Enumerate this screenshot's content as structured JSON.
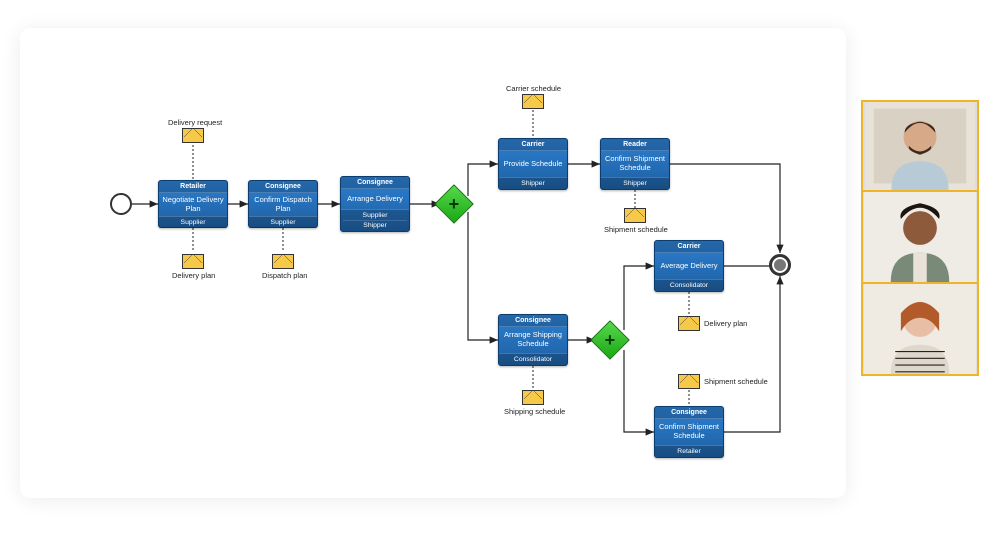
{
  "diagram": {
    "start": {
      "type": "start-event"
    },
    "end": {
      "type": "end-event"
    },
    "gateways": {
      "g1": {
        "symbol": "+"
      },
      "g2": {
        "symbol": "+"
      }
    },
    "tasks": {
      "negotiate": {
        "role_top": "Retailer",
        "title": "Negotiate Delivery Plan",
        "role_bottom": "Supplier"
      },
      "confirmDispatch": {
        "role_top": "Consignee",
        "title": "Confirm Dispatch Plan",
        "role_bottom": "Supplier"
      },
      "arrangeDelivery": {
        "role_top": "Consignee",
        "title": "Arrange Delivery",
        "role_bottom1": "Supplier",
        "role_bottom2": "Shipper"
      },
      "provideSchedule": {
        "role_top": "Carrier",
        "title": "Provide Schedule",
        "role_bottom": "Shipper"
      },
      "confirmShipment1": {
        "role_top": "Reader",
        "title": "Confirm Shipment Schedule",
        "role_bottom": "Shipper"
      },
      "arrangeShipping": {
        "role_top": "Consignee",
        "title": "Arrange Shipping Schedule",
        "role_bottom": "Consolidator"
      },
      "averageDelivery": {
        "role_top": "Carrier",
        "title": "Average Delivery",
        "role_bottom": "Consolidator"
      },
      "confirmShipment2": {
        "role_top": "Consignee",
        "title": "Confirm Shipment Schedule",
        "role_bottom": "Retailer"
      }
    },
    "messages": {
      "deliveryRequest": {
        "label": "Delivery request"
      },
      "deliveryPlan1": {
        "label": "Delivery plan"
      },
      "dispatchPlan": {
        "label": "Dispatch plan"
      },
      "carrierSchedule": {
        "label": "Carrier schedule"
      },
      "shipmentSchedule1": {
        "label": "Shipment schedule"
      },
      "shippingSchedule": {
        "label": "Shipping schedule"
      },
      "deliveryPlan2": {
        "label": "Delivery plan"
      },
      "shipmentSchedule2": {
        "label": "Shipment schedule"
      }
    }
  },
  "participants": {
    "count": 3,
    "people": [
      {
        "name": "participant-1"
      },
      {
        "name": "participant-2"
      },
      {
        "name": "participant-3"
      }
    ]
  },
  "colors": {
    "task_fill": "#1e5fa0",
    "gateway_fill": "#1aa815",
    "envelope_fill": "#f7c948",
    "tile_border": "#f0b429"
  }
}
